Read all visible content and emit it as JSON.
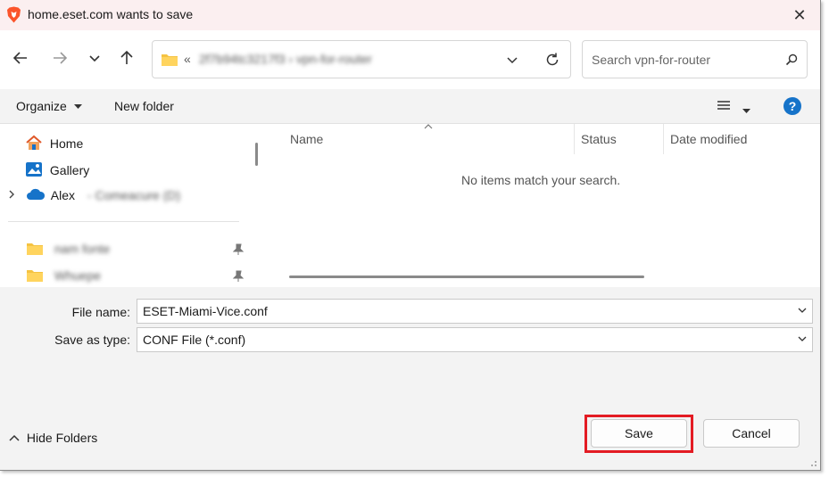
{
  "titlebar": {
    "title": "home.eset.com wants to save",
    "close_icon": "close-icon"
  },
  "nav": {
    "back_icon": "back-arrow-icon",
    "forward_icon": "forward-arrow-icon",
    "recent_icon": "chevron-down-icon",
    "up_icon": "up-arrow-icon",
    "address_prefix": "«",
    "address_path_obscured": "2f7b94tc3217f3  ›  vpn-for-router",
    "refresh_icon": "refresh-icon",
    "search_placeholder": "Search vpn-for-router"
  },
  "toolbar": {
    "organize_label": "Organize",
    "new_folder_label": "New folder",
    "view_icon": "list-view-icon",
    "help_label": "?"
  },
  "sidebar": {
    "items": [
      {
        "label": "Home",
        "icon": "home-icon"
      },
      {
        "label": "Gallery",
        "icon": "gallery-icon"
      },
      {
        "label": "Alex",
        "sublabel": "- Comeacure (D)",
        "icon": "cloud-icon"
      }
    ],
    "pinned": [
      {
        "label": "nam fonte",
        "icon": "folder-icon"
      },
      {
        "label": "Whuepe",
        "icon": "folder-icon"
      }
    ]
  },
  "file_list": {
    "columns": [
      "Name",
      "Status",
      "Date modified"
    ],
    "empty_message": "No items match your search."
  },
  "form": {
    "filename_label": "File name:",
    "filename_value": "ESET-Miami-Vice.conf",
    "type_label": "Save as type:",
    "type_value": "CONF File (*.conf)"
  },
  "footer": {
    "hide_folders_label": "Hide Folders",
    "save_label": "Save",
    "cancel_label": "Cancel"
  },
  "colors": {
    "title_bg": "#fbeff0",
    "accent": "#1673c9",
    "highlight": "#e31b23",
    "pane_bg": "#f3f3f3"
  }
}
